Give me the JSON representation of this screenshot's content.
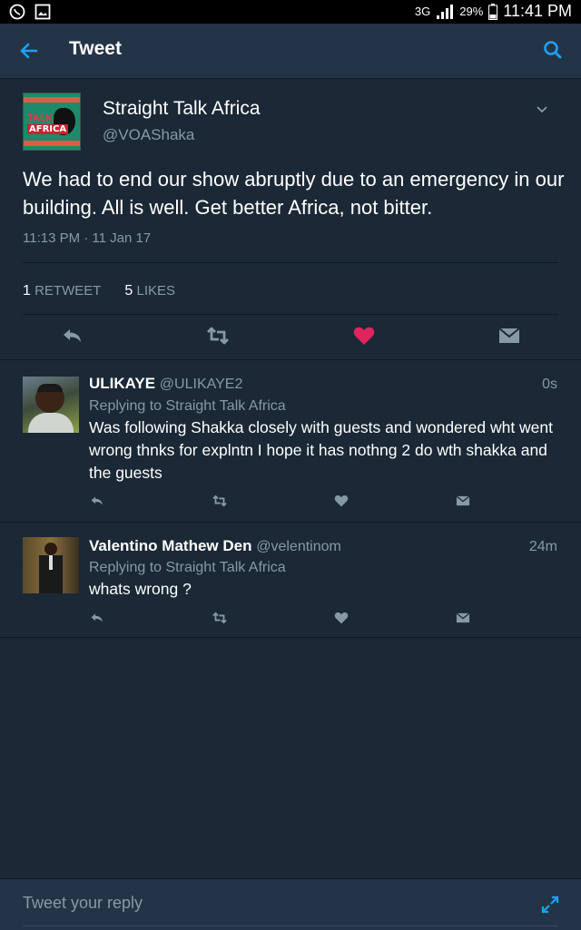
{
  "status_bar": {
    "network": "3G",
    "battery": "29%",
    "time": "11:41 PM"
  },
  "header": {
    "title": "Tweet"
  },
  "tweet": {
    "author_name": "Straight Talk Africa",
    "author_handle": "@VOAShaka",
    "avatar_text_1": "TALK",
    "avatar_text_2": "AFRICA",
    "text": "We had to end our show abruptly due to an emergency in our building. All is well.  Get better Africa, not bitter.",
    "timestamp": "11:13 PM · 11 Jan 17",
    "retweets_count": "1",
    "retweets_label": "RETWEET",
    "likes_count": "5",
    "likes_label": "LIKES",
    "liked_color": "#e0245e"
  },
  "replies": [
    {
      "name": "ULIKAYE",
      "handle": "@ULIKAYE2",
      "time": "0s",
      "replying_to": "Replying to Straight Talk Africa",
      "text": "Was following Shakka closely with guests and wondered wht went wrong thnks for explntn I hope it has nothng 2 do wth shakka and the guests"
    },
    {
      "name": "Valentino Mathew Den",
      "handle": "@velentinom",
      "time": "24m",
      "replying_to": "Replying to Straight Talk Africa",
      "text": "whats wrong ?"
    }
  ],
  "compose": {
    "placeholder": "Tweet your reply"
  },
  "colors": {
    "background": "#1b2836",
    "header": "#243447",
    "accent": "#1da1f2",
    "secondary_text": "#8899a6"
  }
}
